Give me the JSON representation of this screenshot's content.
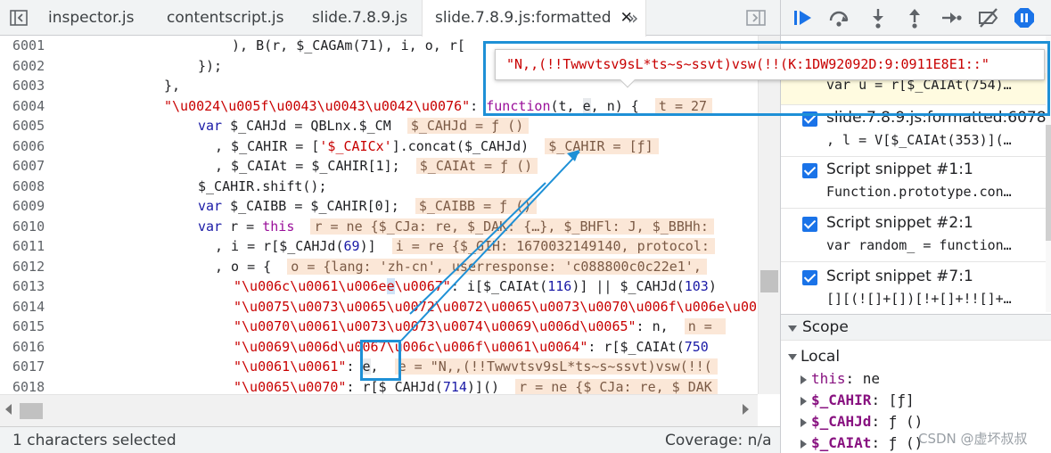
{
  "tabs": [
    {
      "label": "inspector.js"
    },
    {
      "label": "contentscript.js"
    },
    {
      "label": "slide.7.8.9.js"
    },
    {
      "label": "slide.7.8.9.js:formatted",
      "close": "✕"
    }
  ],
  "more_tabs": "»",
  "code": {
    "lines": [
      {
        "no": "6001"
      },
      {
        "no": "6002"
      },
      {
        "no": "6003"
      },
      {
        "no": "6004"
      },
      {
        "no": "6005"
      },
      {
        "no": "6006"
      },
      {
        "no": "6007"
      },
      {
        "no": "6008"
      },
      {
        "no": "6009"
      },
      {
        "no": "6010"
      },
      {
        "no": "6011"
      },
      {
        "no": "6012"
      },
      {
        "no": "6013"
      },
      {
        "no": "6014"
      },
      {
        "no": "6015"
      },
      {
        "no": "6016"
      },
      {
        "no": "6017"
      },
      {
        "no": "6018"
      }
    ],
    "l6001_a": "), B(r, $_CAGAm(71), i, o, r[",
    "l6002": "});",
    "l6003": "},",
    "l6004_str": "\"\\u0024\\u005f\\u0043\\u0043\\u0042\\u0076\"",
    "l6004_colon": ": ",
    "l6004_fn": "function",
    "l6004_args_a": "(t, ",
    "l6004_e": "e",
    "l6004_args_b": ", n) {  ",
    "l6004_inline": "t = 27",
    "l6005_var": "var",
    "l6005_code": " $_CAHJd = QBLnx.$_CM  ",
    "l6005_inline": "$_CAHJd = ƒ ()",
    "l6006_a": ", $_CAHIR = [",
    "l6006_str": "'$_CAICx'",
    "l6006_b": "].concat($_CAHJd)  ",
    "l6006_inline": "$_CAHIR = [ƒ]",
    "l6007_code": ", $_CAIAt = $_CAHIR[1];  ",
    "l6007_inline": "$_CAIAt = ƒ ()",
    "l6008": "$_CAHIR.shift();",
    "l6009_var": "var",
    "l6009_code": " $_CAIBB = $_CAHIR[0];  ",
    "l6009_inline": "$_CAIBB = ƒ ()",
    "l6010_var": "var",
    "l6010_a": " r = ",
    "l6010_this": "this",
    "l6010_b": "  ",
    "l6010_inline": "r = ne {$_CJa: re, $_DAK: {…}, $_BHFl: J, $_BBHh:",
    "l6011_a": ", i = r[$_CAHJd(",
    "l6011_n": "69",
    "l6011_b": ")]  ",
    "l6011_inline": "i = re {$_GIH: 1670032149140, protocol:",
    "l6012_code": ", o = {  ",
    "l6012_inline": "o = {lang: 'zh-cn', userresponse: 'c088800c0c22e1',",
    "l6013_str_a": "\"\\u006c\\u0061\\u006e",
    "l6013_str_b": "\\u0067\"",
    "l6013_a": ": i[$_CAIAt(",
    "l6013_n1": "116",
    "l6013_b": ")] || $_CAHJd(",
    "l6013_n2": "103",
    "l6013_c": ")",
    "l6014_str": "\"\\u0075\\u0073\\u0065\\u0072\\u0072\\u0065\\u0073\\u0070\\u006f\\u006e\\u0073\\u0065\"",
    "l6015_str": "\"\\u0070\\u0061\\u0073\\u0073\\u0074\\u0069\\u006d\\u0065\"",
    "l6015_a": ": n,  ",
    "l6015_inline": "n = ",
    "l6016_str": "\"\\u0069\\u006d\\u0067\\u006c\\u006f\\u0061\\u0064\"",
    "l6016_a": ": r[$_CAIAt(",
    "l6016_n": "750",
    "l6017_str": "\"\\u0061\\u0061\"",
    "l6017_a": ": ",
    "l6017_e": "e",
    "l6017_b": ",  ",
    "l6017_inline": "e = \"N,,(!!Twwvtsv9sL*ts~s~ssvt)vsw(!!(",
    "l6018_str": "\"\\u0065\\u0070\"",
    "l6018_a": ": r[$_CAHJd(",
    "l6018_n": "714",
    "l6018_b": ")]()  ",
    "l6018_inline": "r = ne {$_CJa: re, $_DAK"
  },
  "tooltip": {
    "value": "\"N,,(!!Twwvtsv9sL*ts~s~ssvt)vsw(!!(K:1DW92092D:9:0911E8E1::\""
  },
  "status": {
    "selection": "1 characters selected",
    "coverage": "Coverage: n/a"
  },
  "breakpoints": [
    {
      "title": "",
      "code": "var u = r[$_CAIAt(754)…"
    },
    {
      "title": "slide.7.8.9.js:formatted:6078",
      "code": ", l = V[$_CAIAt(353)](…"
    },
    {
      "title": "Script snippet #1:1",
      "code": "Function.prototype.con…"
    },
    {
      "title": "Script snippet #2:1",
      "code": "var random_ = function…"
    },
    {
      "title": "Script snippet #7:1",
      "code": "[][(![]+[])[!+[]+!![]+…"
    }
  ],
  "scope": {
    "title": "Scope",
    "local_label": "Local",
    "items": [
      {
        "name": "this",
        "sep": ": ",
        "value": "ne"
      },
      {
        "name": "$_CAHIR",
        "sep": ": ",
        "value": "[ƒ]"
      },
      {
        "name": "$_CAHJd",
        "sep": ": ",
        "value": "ƒ ()"
      },
      {
        "name": "$_CAIAt",
        "sep": ": ",
        "value": "ƒ ()"
      }
    ]
  },
  "watermark": "CSDN @虚坏叔叔",
  "colors": {
    "accent_blue": "#1a73e8",
    "annotation_blue": "#1e90d6",
    "string_red": "#c80000",
    "keyword_purple": "#9a0f9a",
    "inline_value_bg": "#fbe7d7"
  }
}
